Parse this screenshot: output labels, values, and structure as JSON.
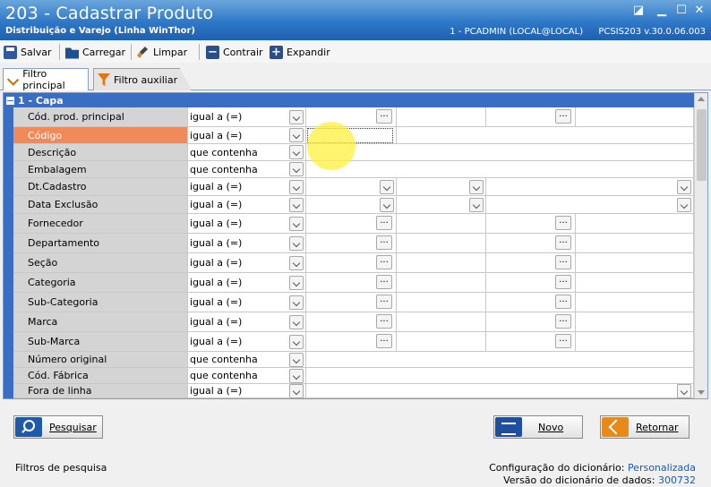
{
  "window": {
    "title": "203 - Cadastrar  Produto",
    "subtitle": "Distribuição e Varejo (Linha WinThor)",
    "user_info": "1 - PCADMIN (LOCAL@LOCAL)",
    "module_info": "PCSIS203  v.30.0.06.003"
  },
  "toolbar": {
    "save_label": "Salvar",
    "load_label": "Carregar",
    "clear_label": "Limpar",
    "collapse_label": "Contrair",
    "expand_label": "Expandir"
  },
  "tabs": [
    {
      "label": "Filtro principal",
      "active": true
    },
    {
      "label": "Filtro auxiliar",
      "active": false
    }
  ],
  "group": {
    "label": "1 - Capa"
  },
  "rows": [
    {
      "label": "Cód. prod. principal",
      "operator": "igual a (=)"
    },
    {
      "label": "Código",
      "operator": "igual a (=)"
    },
    {
      "label": "Descrição",
      "operator": "que contenha"
    },
    {
      "label": "Embalagem",
      "operator": "que contenha"
    },
    {
      "label": "Dt.Cadastro",
      "operator": "igual a (=)"
    },
    {
      "label": "Data Exclusão",
      "operator": "igual a (=)"
    },
    {
      "label": "Fornecedor",
      "operator": "igual a (=)"
    },
    {
      "label": "Departamento",
      "operator": "igual a (=)"
    },
    {
      "label": "Seção",
      "operator": "igual a (=)"
    },
    {
      "label": "Categoria",
      "operator": "igual a (=)"
    },
    {
      "label": "Sub-Categoria",
      "operator": "igual a (=)"
    },
    {
      "label": "Marca",
      "operator": "igual a (=)"
    },
    {
      "label": "Sub-Marca",
      "operator": "igual a (=)"
    },
    {
      "label": "Número original",
      "operator": "que contenha"
    },
    {
      "label": "Cód. Fábrica",
      "operator": "que contenha"
    },
    {
      "label": "Fora de linha",
      "operator": "igual a (=)"
    }
  ],
  "ellipsis": "...",
  "buttons": {
    "search_label": "Pesquisar",
    "new_label": "Novo",
    "back_label": "Retornar"
  },
  "status": {
    "left": "Filtros de pesquisa",
    "dict_config_label": "Configuração do dicionário:",
    "dict_config_value": "Personalizada",
    "dict_version_label": "Versão do dicionário de dados:",
    "dict_version_value": "300732"
  },
  "colors": {
    "titlebar": "#2f78c8",
    "group_header": "#3a6ec4",
    "selected_row": "#f08a5a"
  }
}
